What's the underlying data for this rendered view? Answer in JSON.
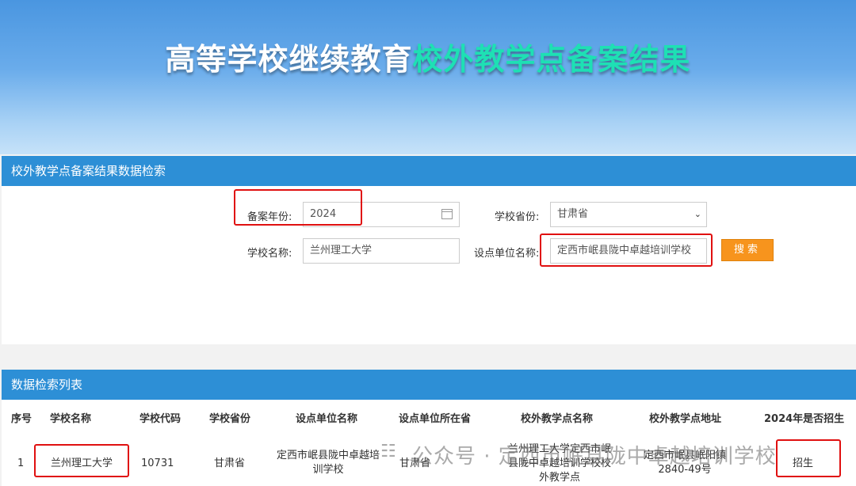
{
  "banner": {
    "title_part1": "高等学校继续教育",
    "title_part2": "校外教学点备案结果"
  },
  "search": {
    "header": "校外教学点备案结果数据检索",
    "year_label": "备案年份:",
    "year_value": "2024",
    "province_label": "学校省份:",
    "province_value": "甘肃省",
    "school_label": "学校名称:",
    "school_value": "兰州理工大学",
    "unit_label": "设点单位名称:",
    "unit_value": "定西市岷县陇中卓越培训学校",
    "search_button": "搜索"
  },
  "results": {
    "header": "数据检索列表",
    "columns": [
      "序号",
      "学校名称",
      "学校代码",
      "学校省份",
      "设点单位名称",
      "设点单位所在省",
      "校外教学点名称",
      "校外教学点地址",
      "2024年是否招生"
    ],
    "rows": [
      {
        "index": "1",
        "school_name": "兰州理工大学",
        "school_code": "10731",
        "school_province": "甘肃省",
        "unit_name": "定西市岷县陇中卓越培训学校",
        "unit_province": "甘肃省",
        "point_name": "兰州理工大学定西市岷县陇中卓越培训学校校外教学点",
        "point_address": "定西市岷县岷阳镇2840-49号",
        "enrolling": "招生"
      }
    ]
  },
  "watermark": {
    "text": "公众号 · 定西市岷县陇中卓越培训学校",
    "icon": "wechat-icon"
  },
  "colors": {
    "header_blue": "#2d8fd6",
    "button_orange": "#f7941d",
    "highlight_red": "#e01010",
    "title_teal": "#1ee0b4"
  }
}
